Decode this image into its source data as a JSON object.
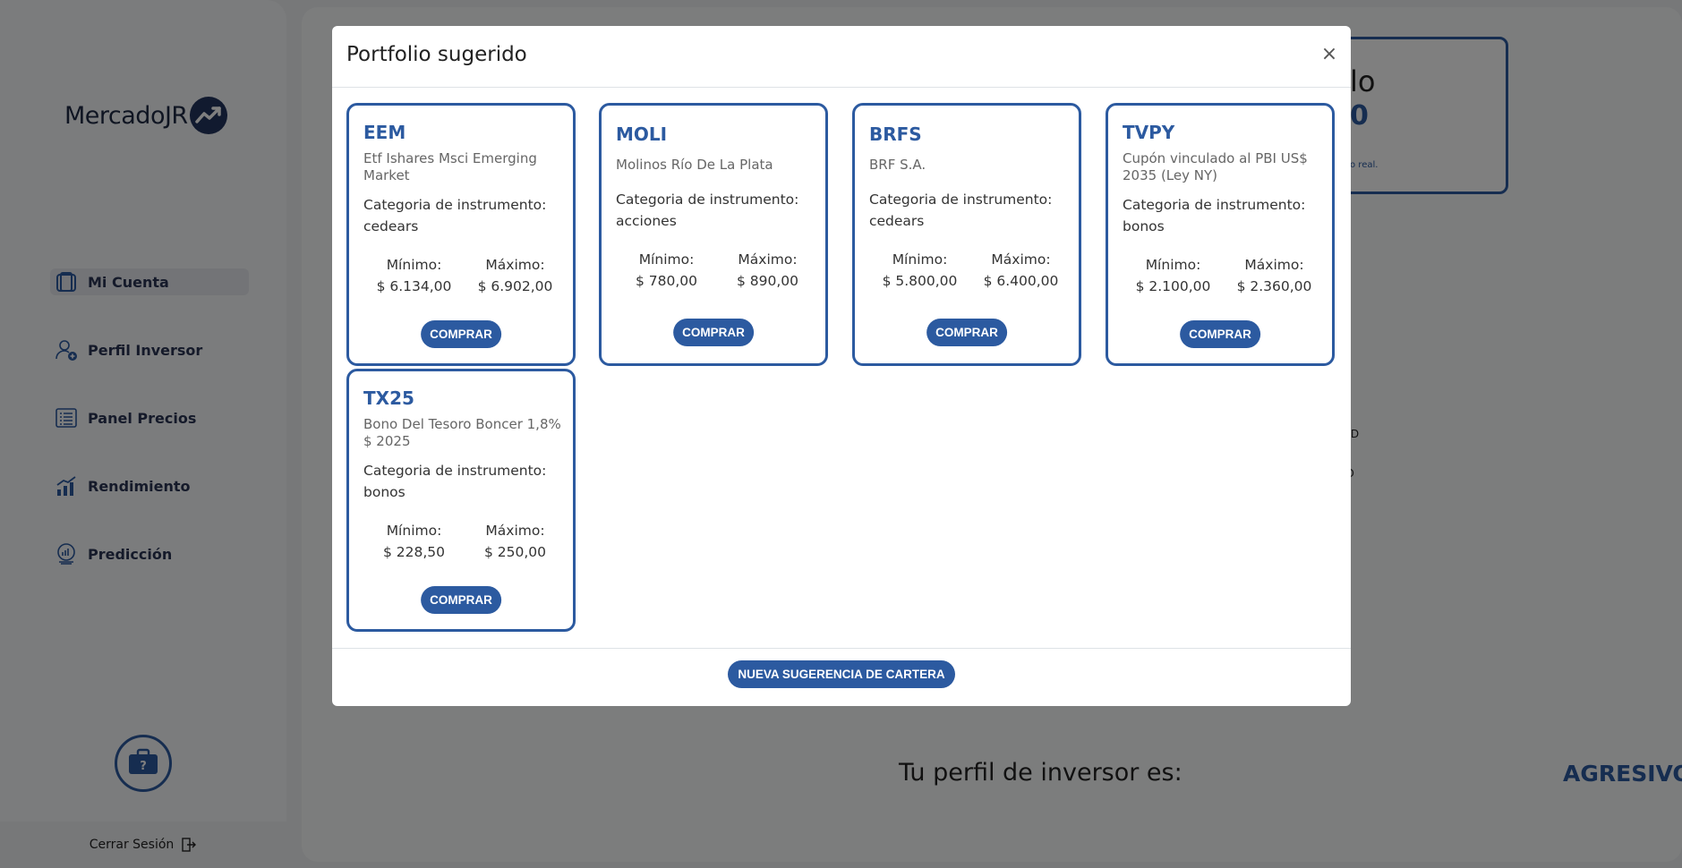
{
  "sidebar": {
    "logo_text": "MercadoJR",
    "items": [
      {
        "label": "Mi Cuenta",
        "icon": "wallet-icon",
        "active": true
      },
      {
        "label": "Perfil Inversor",
        "icon": "user-add-icon",
        "active": false
      },
      {
        "label": "Panel Precios",
        "icon": "list-panel-icon",
        "active": false
      },
      {
        "label": "Rendimiento",
        "icon": "chart-growth-icon",
        "active": false
      },
      {
        "label": "Predicción",
        "icon": "crystal-ball-icon",
        "active": false
      }
    ],
    "logout_label": "Cerrar Sesión"
  },
  "background": {
    "balance_title_fragment": "lo",
    "balance_amount_fragment": "0",
    "balance_note_fragment": "o real.",
    "list_fragments": [
      "PLD",
      "L",
      "RO"
    ],
    "profile_text": "Tu perfil de inversor es:",
    "profile_value": "AGRESIVO"
  },
  "modal": {
    "title": "Portfolio sugerido",
    "close_glyph": "×",
    "category_label": "Categoria de instrumento:",
    "min_label": "Mínimo:",
    "max_label": "Máximo:",
    "buy_label": "COMPRAR",
    "new_suggestion_label": "NUEVA SUGERENCIA DE CARTERA",
    "cards": [
      {
        "ticker": "EEM",
        "name": "Etf Ishares Msci Emerging Market",
        "category": "cedears",
        "min": "$ 6.134,00",
        "max": "$ 6.902,00"
      },
      {
        "ticker": "MOLI",
        "name": "Molinos Río De La Plata",
        "category": "acciones",
        "min": "$ 780,00",
        "max": "$ 890,00"
      },
      {
        "ticker": "BRFS",
        "name": "BRF S.A.",
        "category": "cedears",
        "min": "$ 5.800,00",
        "max": "$ 6.400,00"
      },
      {
        "ticker": "TVPY",
        "name": "Cupón vinculado al PBI US$ 2035 (Ley NY)",
        "category": "bonos",
        "min": "$ 2.100,00",
        "max": "$ 2.360,00"
      },
      {
        "ticker": "TX25",
        "name": "Bono Del Tesoro Boncer 1,8% $ 2025",
        "category": "bonos",
        "min": "$ 228,50",
        "max": "$ 250,00"
      }
    ]
  },
  "colors": {
    "accent": "#2c5aa0",
    "dark": "#23355f",
    "overlay": "rgba(0,0,0,0.5)"
  }
}
